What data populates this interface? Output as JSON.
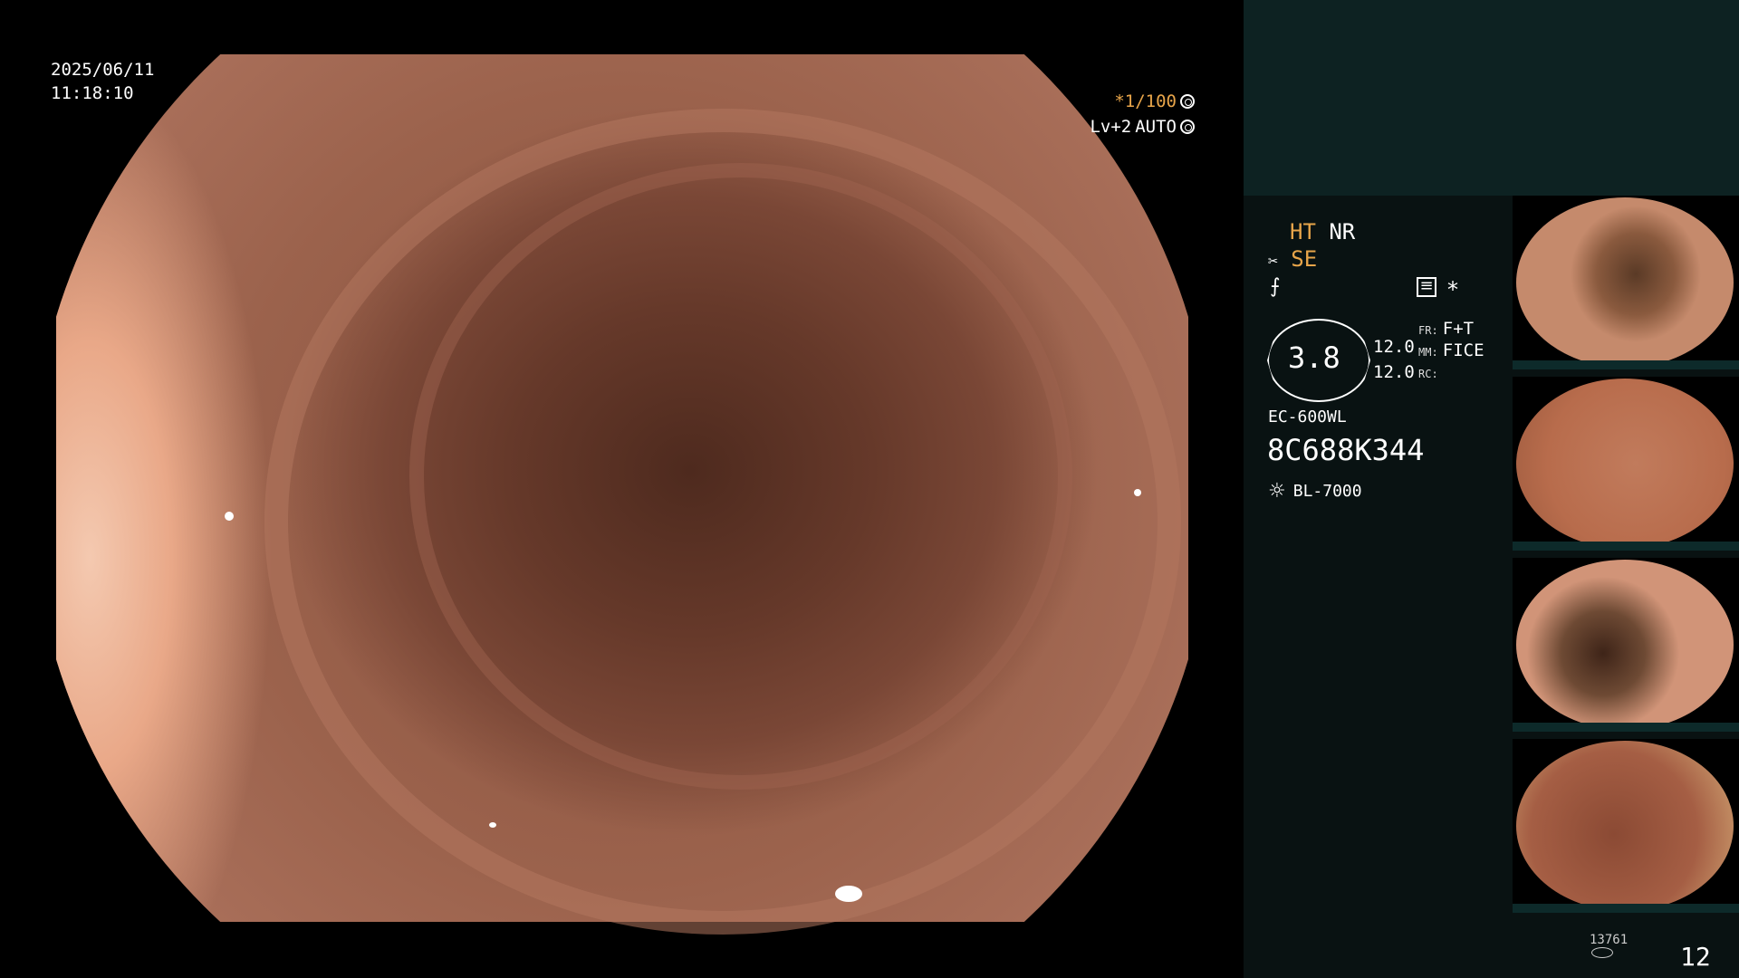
{
  "overlay": {
    "date": "2025/06/11",
    "time": "11:18:10",
    "shutter": "*1/100",
    "level": "Lv+2",
    "mode": "AUTO"
  },
  "panel": {
    "ht": "HT",
    "nr": "NR",
    "se": "SE",
    "asterisk": "*",
    "gauge_value": "3.8",
    "val1": "12.0",
    "val2": "12.0",
    "fr_label": "FR:",
    "fr_value": "F+T",
    "mm_label": "MM:",
    "mm_value": "FICE",
    "rc_label": "RC:",
    "scope_model": "EC-600WL",
    "serial": "8C688K344",
    "light_source": "BL-7000"
  },
  "footer": {
    "storage_count": "13761",
    "page": "12"
  },
  "colors": {
    "accent": "#e8a54a",
    "panel_bg": "#091212",
    "panel_top_bg": "#0d2222"
  },
  "icons": [
    "gear-icon",
    "ring-icon",
    "scissors-icon",
    "wave-icon",
    "menu-icon",
    "lamp-icon",
    "disk-icon"
  ]
}
